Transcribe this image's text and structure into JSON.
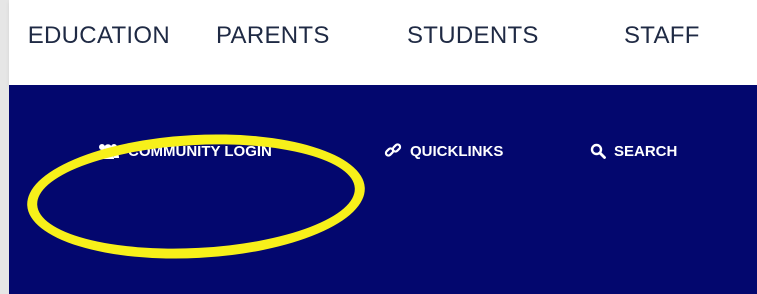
{
  "top_nav": {
    "items": [
      {
        "label": "EDUCATION"
      },
      {
        "label": "PARENTS"
      },
      {
        "label": "STUDENTS"
      },
      {
        "label": "STAFF"
      }
    ]
  },
  "utility_nav": {
    "items": [
      {
        "label": "COMMUNITY LOGIN",
        "icon": "users-icon"
      },
      {
        "label": "QUICKLINKS",
        "icon": "link-icon"
      },
      {
        "label": "SEARCH",
        "icon": "search-icon"
      }
    ]
  },
  "colors": {
    "band": "#03076e",
    "highlight": "#f7f01a",
    "nav_text": "#1f2a44"
  }
}
